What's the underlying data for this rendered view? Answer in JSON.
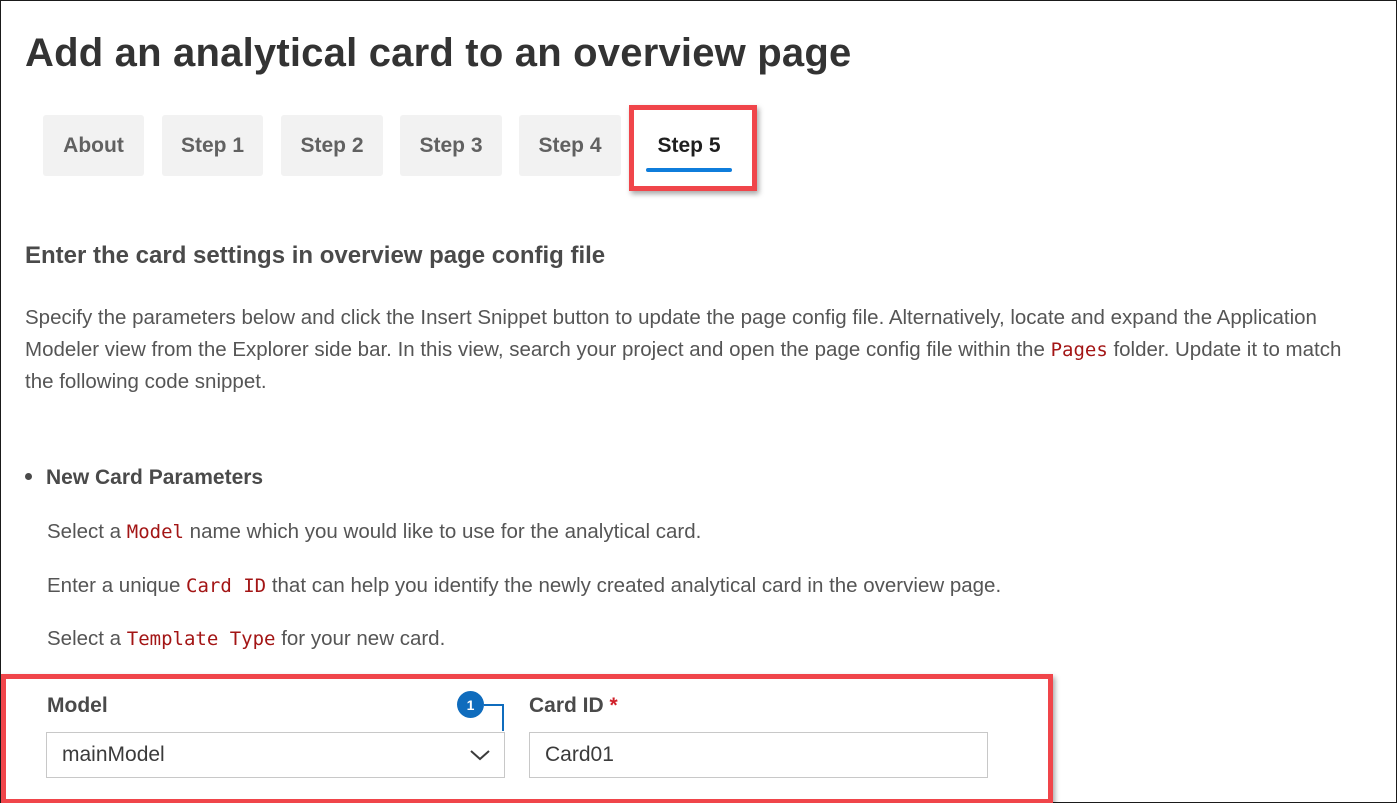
{
  "page": {
    "title": "Add an analytical card to an overview page"
  },
  "tabs": [
    {
      "label": "About",
      "active": false
    },
    {
      "label": "Step 1",
      "active": false
    },
    {
      "label": "Step 2",
      "active": false
    },
    {
      "label": "Step 3",
      "active": false
    },
    {
      "label": "Step 4",
      "active": false
    },
    {
      "label": "Step 5",
      "active": true
    }
  ],
  "content": {
    "heading": "Enter the card settings in overview page config file",
    "paragraph": {
      "text_before": "Specify the parameters below and click the Insert Snippet button to update the page config file. Alternatively, locate and expand the Application Modeler view from the Explorer side bar. In this view, search your project and open the page config file within the ",
      "code": "Pages",
      "text_after": " folder. Update it to match the following code snippet."
    },
    "bullet_title": "New Card Parameters",
    "instructions": [
      {
        "before": "Select a ",
        "code": "Model",
        "after": " name which you would like to use for the analytical card."
      },
      {
        "before": "Enter a unique ",
        "code": "Card ID",
        "after": " that can help you identify the newly created analytical card in the overview page."
      },
      {
        "before": "Select a ",
        "code": "Template Type",
        "after": " for your new card."
      }
    ]
  },
  "form": {
    "model_label": "Model",
    "model_value": "mainModel",
    "card_id_label": "Card ID",
    "card_id_required_marker": "*",
    "card_id_value": "Card01",
    "callout_number": "1"
  },
  "colors": {
    "accent": "#0f7ddb",
    "highlight": "#f0454a",
    "code": "#a31515",
    "required": "#d0202a",
    "badge": "#0f6cbd"
  },
  "icons": {
    "model_dropdown": "chevron-down-icon"
  }
}
